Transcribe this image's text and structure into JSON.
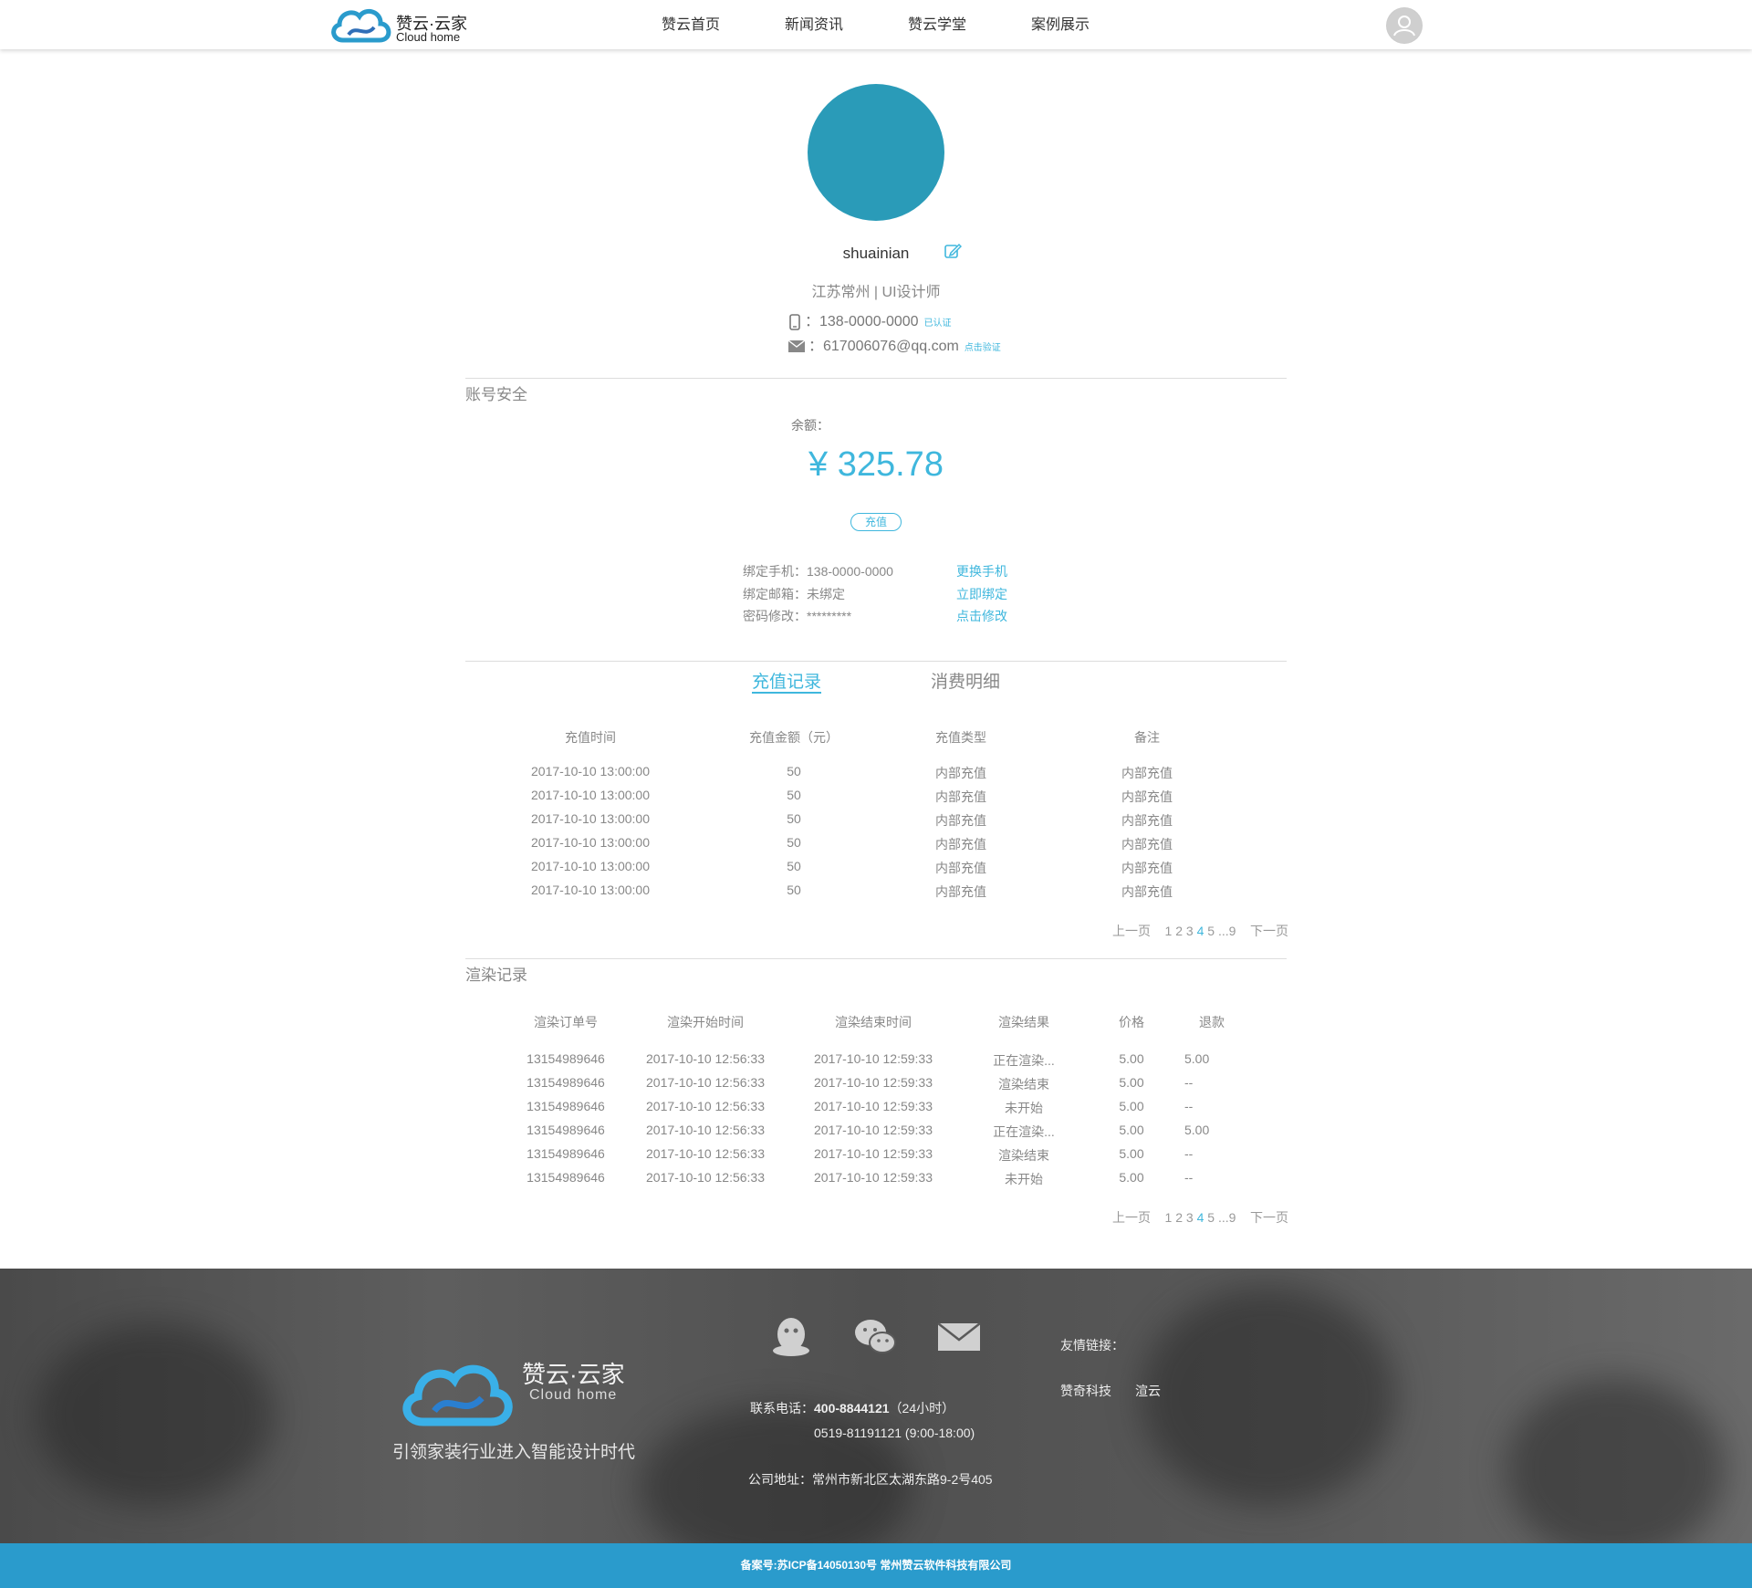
{
  "header": {
    "logo_cn": "赞云·云家",
    "logo_en": "Cloud home",
    "nav": [
      "赞云首页",
      "新闻资讯",
      "赞云学堂",
      "案例展示"
    ]
  },
  "profile": {
    "username": "shuainian",
    "location_job": "江苏常州 | UI设计师",
    "phone": "：138-0000-0000",
    "phone_status": "已认证",
    "email": "：617006076@qq.com",
    "email_action": "点击验证"
  },
  "account": {
    "section_title": "账号安全",
    "balance_label": "余额：",
    "balance": "¥ 325.78",
    "recharge_button": "充值",
    "rows": [
      {
        "label": "绑定手机：138-0000-0000",
        "action": "更换手机"
      },
      {
        "label": "绑定邮箱：未绑定",
        "action": "立即绑定"
      },
      {
        "label": "密码修改：*********",
        "action": "点击修改"
      }
    ]
  },
  "tabs": [
    "充值记录",
    "消费明细"
  ],
  "recharge": {
    "headers": [
      "充值时间",
      "充值金额（元）",
      "充值类型",
      "备注"
    ],
    "rows": [
      [
        "2017-10-10 13:00:00",
        "50",
        "内部充值",
        "内部充值"
      ],
      [
        "2017-10-10 13:00:00",
        "50",
        "内部充值",
        "内部充值"
      ],
      [
        "2017-10-10 13:00:00",
        "50",
        "内部充值",
        "内部充值"
      ],
      [
        "2017-10-10 13:00:00",
        "50",
        "内部充值",
        "内部充值"
      ],
      [
        "2017-10-10 13:00:00",
        "50",
        "内部充值",
        "内部充值"
      ],
      [
        "2017-10-10 13:00:00",
        "50",
        "内部充值",
        "内部充值"
      ]
    ]
  },
  "pager": {
    "prev": "上一页",
    "pages": [
      "1",
      "2",
      "3",
      "4",
      "5"
    ],
    "current": "4",
    "ellipsis": "...9",
    "next": "下一页"
  },
  "render": {
    "section_title": "渲染记录",
    "headers": [
      "渲染订单号",
      "渲染开始时间",
      "渲染结束时间",
      "渲染结果",
      "价格",
      "退款"
    ],
    "rows": [
      [
        "13154989646",
        "2017-10-10  12:56:33",
        "2017-10-10  12:59:33",
        "正在渲染...",
        "5.00",
        "5.00"
      ],
      [
        "13154989646",
        "2017-10-10  12:56:33",
        "2017-10-10  12:59:33",
        "渲染结束",
        "5.00",
        "--"
      ],
      [
        "13154989646",
        "2017-10-10  12:56:33",
        "2017-10-10  12:59:33",
        "未开始",
        "5.00",
        "--"
      ],
      [
        "13154989646",
        "2017-10-10  12:56:33",
        "2017-10-10  12:59:33",
        "正在渲染...",
        "5.00",
        "5.00"
      ],
      [
        "13154989646",
        "2017-10-10  12:56:33",
        "2017-10-10  12:59:33",
        "渲染结束",
        "5.00",
        "--"
      ],
      [
        "13154989646",
        "2017-10-10  12:56:33",
        "2017-10-10  12:59:33",
        "未开始",
        "5.00",
        "--"
      ]
    ]
  },
  "footer": {
    "logo_cn": "赞云·云家",
    "logo_en": "Cloud home",
    "slogan": "引领家装行业进入智能设计时代",
    "icons": [
      "qq-icon",
      "wechat-icon",
      "mail-icon"
    ],
    "phone_label": "联系电话：",
    "phone_main": "400-8844121",
    "phone_hours": "（24小时）",
    "phone_alt": "0519-81191121 (9:00-18:00)",
    "address": "公司地址：常州市新北区太湖东路9-2号405",
    "links_label": "友情链接：",
    "links": [
      "赞奇科技",
      "渲云"
    ]
  },
  "icp": "备案号:苏ICP备14050130号    常州赞云软件科技有限公司",
  "colors": {
    "accent": "#3fb7dd",
    "avatar": "#2a9bb8",
    "icp_bar": "#2a9bcc"
  }
}
